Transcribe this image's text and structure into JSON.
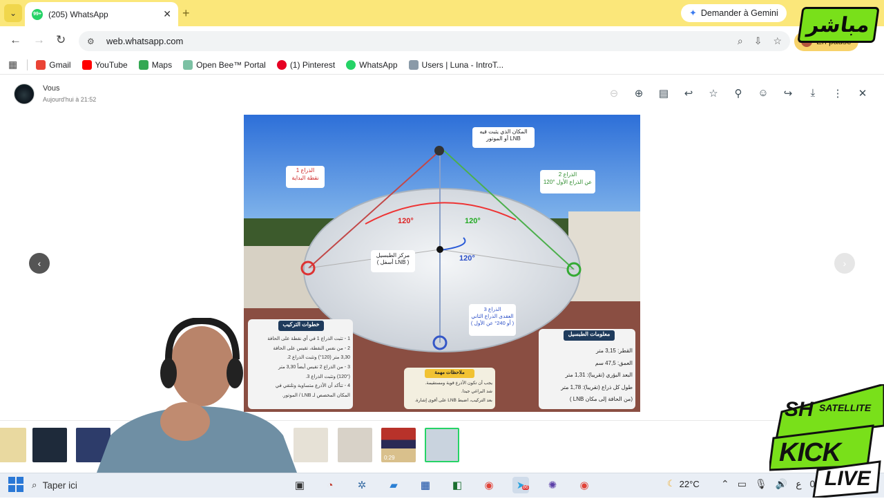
{
  "browser": {
    "tab_title": "(205) WhatsApp",
    "tab_badge": "99+",
    "url": "web.whatsapp.com",
    "gemini_label": "Demander à Gemini",
    "profile_label": "En pause",
    "bookmarks": [
      {
        "label": "Gmail",
        "color": "#ea4335"
      },
      {
        "label": "YouTube",
        "color": "#ff0000"
      },
      {
        "label": "Maps",
        "color": "#34a853"
      },
      {
        "label": "Open Bee™ Portal",
        "color": "#7cc1a4"
      },
      {
        "label": "(1) Pinterest",
        "color": "#e60023"
      },
      {
        "label": "WhatsApp",
        "color": "#25d366"
      },
      {
        "label": "Users | Luna - IntroT...",
        "color": "#8a9aa8"
      }
    ]
  },
  "viewer": {
    "sender": "Vous",
    "time": "Aujourd'hui à 21:52",
    "icons": [
      "zoom-out-icon",
      "zoom-in-icon",
      "caption-icon",
      "reply-icon",
      "star-icon",
      "pin-icon",
      "emoji-icon",
      "forward-icon",
      "download-icon",
      "more-icon",
      "close-icon"
    ]
  },
  "image": {
    "lnb_box": "المكان الذي يثبت فيه\nLNB أو الموتور",
    "arm1_box": "الذراع 1\nنقطة البداية",
    "arm2_box": "الذراع 2\n120° عن الذراع الأول",
    "arm3_box": "الذراع 3\nالعقدى الذراع الثاني\n( أو 240° عن الأول )",
    "center_box": "مركز الطبسيل\n( أسفل LNB )",
    "angle_left": "120°",
    "angle_right": "120°",
    "angle_bottom": "120°",
    "steps_title": "خطوات التركيب",
    "steps": [
      "1 - تثبت الذراع 1 في أي نقطة على الحافة",
      "2 - من نفس النقطة، تقيس على الحافة",
      "3,30 متر (120°) وتثبت الذراع 2.",
      "3 - من الذراع 2 تقيس أيضاً 3,30 متر",
      "(120°) وتثبت الذراع 3.",
      "4 - تتأكد أن الأذرع متساوية وتلتقي في",
      "المكان المخصص لـ LNB / الموتور."
    ],
    "notes_title": "ملاحظات مهمة",
    "notes": [
      "يجب أن تكون الأذرع قوية ومستقيمة.",
      "شد البراغي جيدا.",
      "بعد التركيب، اضبط LNB على أقوى إشارة."
    ],
    "info_title": "معلومات الطبسيل",
    "info": [
      "القطر: 3,15 متر",
      "العمق: 47,5 سم",
      "البعد البؤري (تقريبا): 1,31 متر",
      "طول كل ذراع (تقريبا): 1,78 متر",
      "(من الحافة إلى مكان LNB )"
    ]
  },
  "thumbs": [
    {
      "kind": "grid",
      "color": "#e9d9a0"
    },
    {
      "kind": "dark",
      "color": "#1e2a3a"
    },
    {
      "kind": "screen",
      "color": "#2d3c6a"
    },
    {
      "kind": "hidden",
      "color": "#444"
    },
    {
      "kind": "paper",
      "color": "#e6e1d6"
    },
    {
      "kind": "paper2",
      "color": "#d8d2c8"
    },
    {
      "kind": "video",
      "color": "#b8322a",
      "duration": "0:29"
    },
    {
      "kind": "dish",
      "color": "#c9d3de"
    }
  ],
  "taskbar": {
    "search_placeholder": "Taper ici",
    "temperature": "22°C",
    "lang": "ع",
    "telegram_badge": "86",
    "clock_partial": "0"
  },
  "overlays": {
    "channel_logo": "مباشر",
    "badge_sh": "SH",
    "badge_satellite": "SATELLITE",
    "badge_kick": "KICK",
    "badge_live": "LIVE"
  },
  "colors": {
    "tab_strip": "#fbe77a",
    "whatsapp_green": "#25d366",
    "kick_green": "#79e01a"
  }
}
